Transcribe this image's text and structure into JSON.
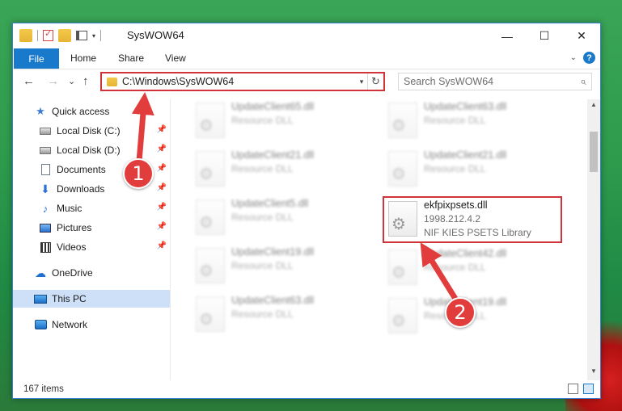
{
  "window": {
    "title": "SysWOW64",
    "controls": {
      "minimize": "—",
      "maximize": "☐",
      "close": "✕"
    }
  },
  "ribbon": {
    "file": "File",
    "tabs": [
      "Home",
      "Share",
      "View"
    ],
    "help": "?"
  },
  "nav": {
    "back": "←",
    "forward": "→",
    "recent": "⌄",
    "up": "↑",
    "address": "C:\\Windows\\SysWOW64",
    "search_placeholder": "Search SysWOW64"
  },
  "sidebar": {
    "items": [
      {
        "label": "Quick access",
        "icon": "star-icon"
      },
      {
        "label": "Local Disk (C:)",
        "icon": "disk-icon"
      },
      {
        "label": "Local Disk (D:)",
        "icon": "disk-icon"
      },
      {
        "label": "Documents",
        "icon": "documents-icon"
      },
      {
        "label": "Downloads",
        "icon": "downloads-icon"
      },
      {
        "label": "Music",
        "icon": "music-icon"
      },
      {
        "label": "Pictures",
        "icon": "pictures-icon"
      },
      {
        "label": "Videos",
        "icon": "videos-icon"
      },
      {
        "label": "OneDrive",
        "icon": "onedrive-icon"
      },
      {
        "label": "This PC",
        "icon": "this-pc-icon"
      },
      {
        "label": "Network",
        "icon": "network-icon"
      }
    ]
  },
  "files": {
    "left": [
      {
        "name": "UpdateClient65.dll",
        "type": "Resource DLL"
      },
      {
        "name": "UpdateClient21.dll",
        "type": "Resource DLL"
      },
      {
        "name": "UpdateClient5.dll",
        "type": "Resource DLL"
      },
      {
        "name": "UpdateClient19.dll",
        "type": "Resource DLL"
      },
      {
        "name": "UpdateClient63.dll",
        "type": "Resource DLL"
      }
    ],
    "right": [
      {
        "name": "UpdateClient63.dll",
        "type": "Resource DLL"
      },
      {
        "name": "UpdateClient21.dll",
        "type": "Resource DLL"
      },
      {
        "name": "UpdateClient42.dll",
        "type": "Resource DLL"
      },
      {
        "name": "UpdateClient19.dll",
        "type": "Resource DLL"
      }
    ],
    "target": {
      "name": "ekfpixpsets.dll",
      "version": "1998.212.4.2",
      "description": "NIF KIES PSETS Library"
    }
  },
  "status": {
    "count": "167 items"
  },
  "annotations": {
    "step1": "1",
    "step2": "2",
    "color": "#e23d3d"
  }
}
